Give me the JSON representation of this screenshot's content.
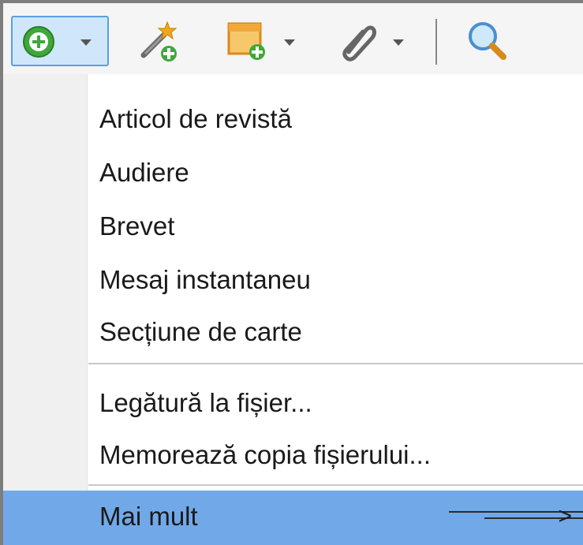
{
  "toolbar": {
    "buttons": [
      {
        "name": "new-item",
        "icon": "green-plus-circle-icon",
        "has_dropdown": true
      },
      {
        "name": "add-by-identifier",
        "icon": "magic-wand-plus-icon",
        "has_dropdown": false
      },
      {
        "name": "new-note",
        "icon": "note-plus-icon",
        "has_dropdown": true
      },
      {
        "name": "add-attachment",
        "icon": "paperclip-icon",
        "has_dropdown": true
      },
      {
        "name": "search",
        "icon": "magnifier-icon",
        "has_dropdown": false
      }
    ],
    "colors": {
      "selected_bg": "#cfe6fb",
      "selected_border": "#5aa0e0"
    }
  },
  "menu": {
    "items_group1": [
      {
        "label": "Articol de revistă"
      },
      {
        "label": "Audiere"
      },
      {
        "label": "Brevet"
      },
      {
        "label": "Mesaj instantaneu"
      },
      {
        "label": "Secțiune de carte"
      }
    ],
    "items_group2": [
      {
        "label": "Legătură la fișier..."
      },
      {
        "label": "Memorează copia fișierului..."
      }
    ],
    "more": {
      "label": "Mai mult",
      "submenu_glyph": ">",
      "highlighted": true
    },
    "colors": {
      "highlight": "#71a9e8",
      "gutter": "#f0f0f0"
    }
  }
}
